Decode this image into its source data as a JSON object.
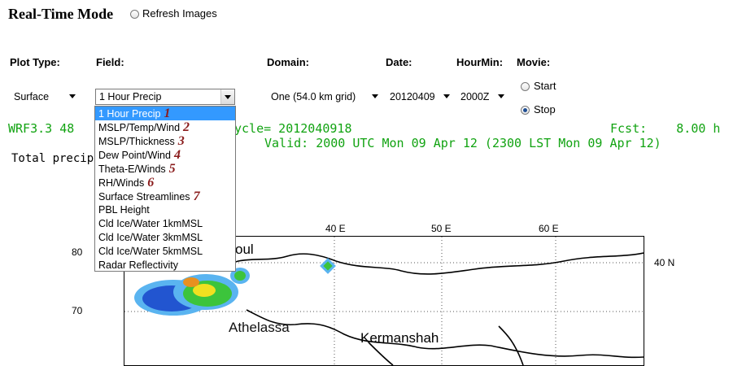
{
  "header": {
    "title": "Real-Time Mode",
    "refresh_label": "Refresh Images"
  },
  "labels": {
    "plot_type": "Plot Type:",
    "field": "Field:",
    "domain": "Domain:",
    "date": "Date:",
    "hourmin": "HourMin:",
    "movie": "Movie:"
  },
  "selects": {
    "plot_type": "Surface",
    "field": "1 Hour Precip",
    "domain": "One (54.0 km grid)",
    "date": "20120409",
    "hourmin": "2000Z"
  },
  "movie": {
    "start": "Start",
    "stop": "Stop",
    "selected": "Stop"
  },
  "field_options": [
    {
      "label": "1 Hour Precip",
      "marker": "1"
    },
    {
      "label": "MSLP/Temp/Wind",
      "marker": "2"
    },
    {
      "label": "MSLP/Thickness",
      "marker": "3"
    },
    {
      "label": "Dew Point/Wind",
      "marker": "4"
    },
    {
      "label": "Theta-E/Winds",
      "marker": "5"
    },
    {
      "label": "RH/Winds",
      "marker": "6"
    },
    {
      "label": "Surface Streamlines",
      "marker": "7"
    },
    {
      "label": "PBL Height",
      "marker": ""
    },
    {
      "label": "Cld Ice/Water 1kmMSL",
      "marker": ""
    },
    {
      "label": "Cld Ice/Water 3kmMSL",
      "marker": ""
    },
    {
      "label": "Cld Ice/Water 5kmMSL",
      "marker": ""
    },
    {
      "label": "Radar Reflectivity",
      "marker": ""
    }
  ],
  "info": {
    "model": "WRF3.3 48",
    "cycle": "ycle= 2012040918",
    "fcst": "Fcst:    8.00 h",
    "valid": "Valid: 2000 UTC Mon 09 Apr 12 (2300 LST Mon 09 Apr 12)",
    "total": "Total precip"
  },
  "map": {
    "lon_labels": [
      "E",
      "40 E",
      "50 E",
      "60 E"
    ],
    "lat_left": [
      "80",
      "70"
    ],
    "lat_right": "40 N",
    "places": [
      "oul",
      "Athelassa",
      "Kermanshah"
    ],
    "precip_colors": {
      "light": "#5ab4f0",
      "blue": "#2255d0",
      "green": "#3cc43c",
      "yellow": "#f0e020",
      "orange": "#e89020"
    }
  }
}
